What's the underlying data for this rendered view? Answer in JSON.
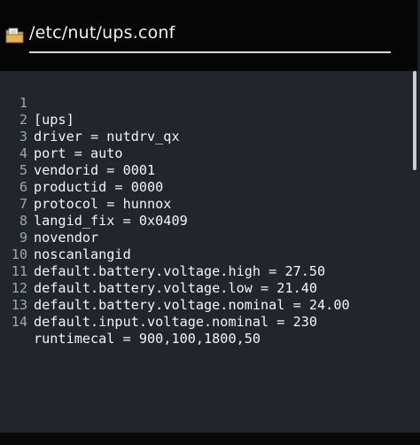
{
  "header": {
    "path": "/etc/nut/ups.conf",
    "icon": "folder-file-icon"
  },
  "editor": {
    "lines": [
      {
        "num": "1",
        "text": "[ups]"
      },
      {
        "num": "2",
        "text": "driver = nutdrv_qx"
      },
      {
        "num": "3",
        "text": "port = auto"
      },
      {
        "num": "4",
        "text": "vendorid = 0001"
      },
      {
        "num": "5",
        "text": "productid = 0000"
      },
      {
        "num": "6",
        "text": "protocol = hunnox"
      },
      {
        "num": "7",
        "text": "langid_fix = 0x0409"
      },
      {
        "num": "8",
        "text": "novendor"
      },
      {
        "num": "9",
        "text": "noscanlangid"
      },
      {
        "num": "10",
        "text": "default.battery.voltage.high = 27.50"
      },
      {
        "num": "11",
        "text": "default.battery.voltage.low = 21.40"
      },
      {
        "num": "12",
        "text": "default.battery.voltage.nominal = 24.00"
      },
      {
        "num": "13",
        "text": "default.input.voltage.nominal = 230"
      },
      {
        "num": "14",
        "text": "runtimecal = 900,100,1800,50"
      }
    ]
  },
  "colors": {
    "header_bg": "#050505",
    "editor_bg": "#22252c",
    "line_number": "#9fa6ae",
    "code_text": "#f4f4f4"
  }
}
